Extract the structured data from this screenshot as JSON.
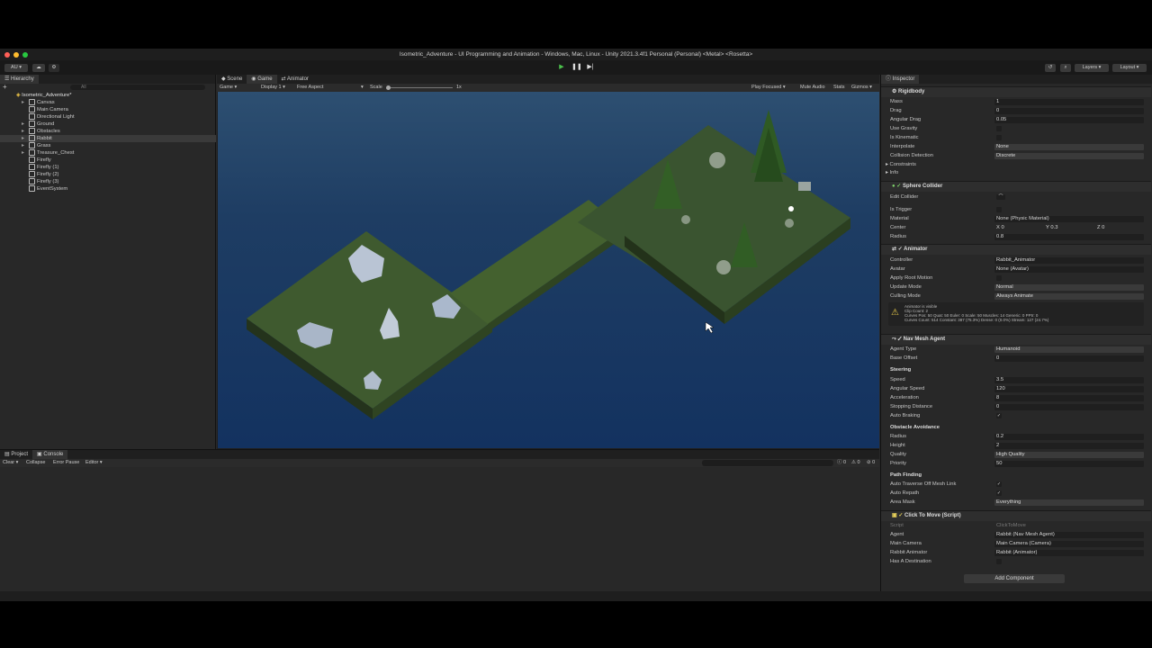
{
  "window": {
    "title": "Isometric_Adventure - UI Programming and Animation - Windows, Mac, Linux - Unity 2021.3.4f1 Personal (Personal) <Metal> <Rosetta>"
  },
  "toolbar": {
    "account": "AU",
    "layers": "Layers",
    "layout": "Layout",
    "icons": [
      "cloud-icon",
      "collab-icon",
      "play-icon",
      "pause-icon",
      "step-icon",
      "history-icon",
      "search-icon"
    ]
  },
  "hierarchy": {
    "title": "Hierarchy",
    "add": "+",
    "search_placeholder": "All",
    "scene": "Isometric_Adventure*",
    "items": [
      {
        "label": "Canvas",
        "arrow": "▸"
      },
      {
        "label": "Main Camera",
        "arrow": ""
      },
      {
        "label": "Directional Light",
        "arrow": ""
      },
      {
        "label": "Ground",
        "arrow": "▸"
      },
      {
        "label": "Obstacles",
        "arrow": "▸"
      },
      {
        "label": "Rabbit",
        "arrow": "▸"
      },
      {
        "label": "Grass",
        "arrow": "▸"
      },
      {
        "label": "Treasure_Chest",
        "arrow": "▸"
      },
      {
        "label": "Firefly",
        "arrow": ""
      },
      {
        "label": "Firefly (1)",
        "arrow": ""
      },
      {
        "label": "Firefly (2)",
        "arrow": ""
      },
      {
        "label": "Firefly (3)",
        "arrow": ""
      },
      {
        "label": "EventSystem",
        "arrow": ""
      }
    ]
  },
  "game_view": {
    "tabs": [
      "Scene",
      "Game",
      "Animator"
    ],
    "mode": "Game",
    "display": "Display 1",
    "aspect": "Free Aspect",
    "scale_label": "Scale",
    "scale_value": "1x",
    "play_focused": "Play Focused",
    "mute_audio": "Mute Audio",
    "stats": "Stats",
    "gizmos": "Gizmos"
  },
  "console": {
    "tabs": [
      "Project",
      "Console"
    ],
    "clear": "Clear",
    "collapse": "Collapse",
    "error_pause": "Error Pause",
    "editor": "Editor",
    "counts": [
      "0",
      "0",
      "0"
    ]
  },
  "inspector": {
    "title": "Inspector",
    "rigidbody": {
      "title": "Rigidbody",
      "mass_label": "Mass",
      "mass": "1",
      "drag_label": "Drag",
      "drag": "0",
      "angular_drag_label": "Angular Drag",
      "angular_drag": "0.05",
      "use_gravity_label": "Use Gravity",
      "is_kinematic_label": "Is Kinematic",
      "interpolate_label": "Interpolate",
      "interpolate": "None",
      "collision_label": "Collision Detection",
      "collision": "Discrete",
      "constraints_label": "Constraints",
      "info_label": "Info"
    },
    "sphere": {
      "title": "Sphere Collider",
      "edit_label": "Edit Collider",
      "trigger_label": "Is Trigger",
      "material_label": "Material",
      "material": "None (Physic Material)",
      "center_label": "Center",
      "cx": "0",
      "cy": "0.3",
      "cz": "0",
      "radius_label": "Radius",
      "radius": "0.8"
    },
    "animator": {
      "title": "Animator",
      "controller_label": "Controller",
      "controller": "Rabbit_Animator",
      "avatar_label": "Avatar",
      "avatar": "None (Avatar)",
      "root_label": "Apply Root Motion",
      "update_label": "Update Mode",
      "update": "Normal",
      "culling_label": "Culling Mode",
      "culling": "Always Animate",
      "info1": "Animator is visible",
      "info2": "Clip Count: 2",
      "info3": "Curves Pos: 50 Quat: 50 Euler: 0 Scale: 50 Muscles: 14 Generic: 0 PPtr: 0",
      "info4": "Curves Count: 514 Constant: 387 (75.3%) Dense: 0 (0.0%) Stream: 127 (24.7%)"
    },
    "navmesh": {
      "title": "Nav Mesh Agent",
      "agent_type_label": "Agent Type",
      "agent_type": "Humanoid",
      "base_offset_label": "Base Offset",
      "base_offset": "0",
      "steering": "Steering",
      "speed_label": "Speed",
      "speed": "3.5",
      "ang_speed_label": "Angular Speed",
      "ang_speed": "120",
      "accel_label": "Acceleration",
      "accel": "8",
      "stop_label": "Stopping Distance",
      "stop": "0",
      "brake_label": "Auto Braking",
      "avoid": "Obstacle Avoidance",
      "radius_label": "Radius",
      "radius": "0.2",
      "height_label": "Height",
      "height": "2",
      "quality_label": "Quality",
      "quality": "High Quality",
      "priority_label": "Priority",
      "priority": "50",
      "path": "Path Finding",
      "traverse_label": "Auto Traverse Off Mesh Link",
      "repath_label": "Auto Repath",
      "area_label": "Area Mask",
      "area": "Everything"
    },
    "script": {
      "title": "Click To Move (Script)",
      "script_label": "Script",
      "script": "ClickToMove",
      "agent_label": "Agent",
      "agent": "Rabbit (Nav Mesh Agent)",
      "camera_label": "Main Camera",
      "camera": "Main Camera (Camera)",
      "rabbit_anim_label": "Rabbit Animator",
      "rabbit_anim": "Rabbit (Animator)",
      "dest_label": "Has A Destination"
    },
    "add_component": "Add Component"
  },
  "colors": {
    "panel": "#282828",
    "toolbar": "#191919",
    "sky_top": "#2d4f71",
    "sky_bottom": "#133260",
    "grass": "#3f5a2f",
    "accent": "#4a9cff"
  }
}
